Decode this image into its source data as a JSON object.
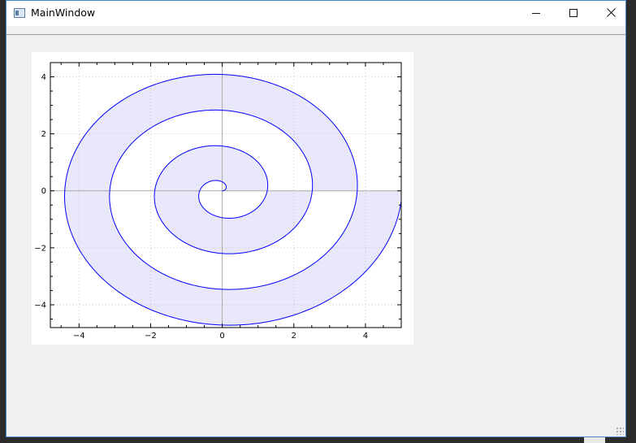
{
  "window": {
    "title": "MainWindow",
    "minimize_glyph": "—",
    "maximize_glyph": "☐",
    "close_glyph": "✕",
    "accent_border": "#4a89c9"
  },
  "icons": {
    "app": "app-window-icon",
    "minimize": "minimize-icon",
    "maximize": "maximize-icon",
    "close": "close-icon",
    "grip": "size-grip-icon"
  },
  "chart_data": {
    "type": "line",
    "description_of_series": "Archimedean spiral r = 0.2*theta with filled region between curve and y=0 baseline",
    "series": [
      {
        "equation": "x = 0.2*t*cos(t), y = 0.2*t*sin(t)",
        "t_range": [
          0,
          25.132741
        ],
        "line_color": "#0000ff",
        "fill_color": "#e8e8fa",
        "fill_to": 0
      }
    ],
    "xlim": [
      -4.8,
      5.0
    ],
    "ylim": [
      -4.8,
      4.5
    ],
    "x_ticks": [
      -4,
      -2,
      0,
      2,
      4
    ],
    "y_ticks": [
      -4,
      -2,
      0,
      2,
      4
    ],
    "x_tick_labels": [
      "−4",
      "−2",
      "0",
      "2",
      "4"
    ],
    "y_tick_labels": [
      "−4",
      "−2",
      "0",
      "2",
      "4"
    ],
    "grid": true,
    "zero_lines": true,
    "title": "",
    "xlabel": "",
    "ylabel": ""
  }
}
